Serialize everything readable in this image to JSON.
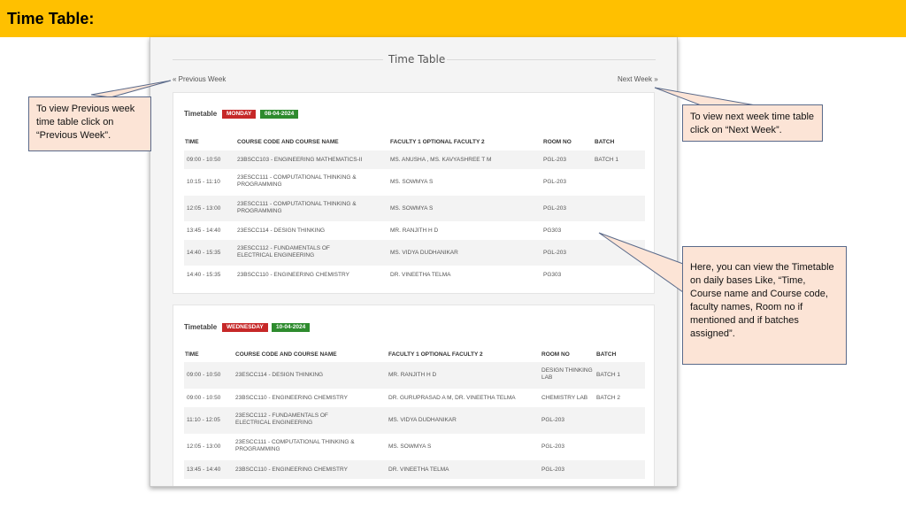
{
  "page": {
    "title": "Time Table:"
  },
  "screenshot": {
    "header": "Time Table",
    "prev_week": "« Previous Week",
    "next_week": "Next Week »",
    "columns": [
      "TIME",
      "COURSE CODE AND COURSE NAME",
      "FACULTY 1 OPTIONAL FACULTY 2",
      "ROOM NO",
      "BATCH"
    ],
    "cards": [
      {
        "label": "Timetable",
        "day": "MONDAY",
        "date": "08-04-2024",
        "rows": [
          {
            "time": "09:00 - 10:50",
            "course": "23BSCC103 - ENGINEERING MATHEMATICS-II",
            "faculty": "MS. ANUSHA , MS. KAVYASHREE T M",
            "room": "PGL-203",
            "batch": "BATCH 1"
          },
          {
            "time": "10:15 - 11:10",
            "course": "23ESCC111 - COMPUTATIONAL THINKING & PROGRAMMING",
            "faculty": "MS. SOWMYA S",
            "room": "PGL-203",
            "batch": ""
          },
          {
            "time": "12:05 - 13:00",
            "course": "23ESCC111 - COMPUTATIONAL THINKING & PROGRAMMING",
            "faculty": "MS. SOWMYA S",
            "room": "PGL-203",
            "batch": ""
          },
          {
            "time": "13:45 - 14:40",
            "course": "23ESCC114 - DESIGN THINKING",
            "faculty": "MR. RANJITH H D",
            "room": "PG303",
            "batch": ""
          },
          {
            "time": "14:40 - 15:35",
            "course": "23ESCC112 - FUNDAMENTALS OF ELECTRICAL ENGINEERING",
            "faculty": "MS. VIDYA DUDHANIKAR",
            "room": "PGL-203",
            "batch": ""
          },
          {
            "time": "14:40 - 15:35",
            "course": "23BSCC110 - ENGINEERING CHEMISTRY",
            "faculty": "DR. VINEETHA TELMA",
            "room": "PG303",
            "batch": ""
          }
        ]
      },
      {
        "label": "Timetable",
        "day": "WEDNESDAY",
        "date": "10-04-2024",
        "rows": [
          {
            "time": "09:00 - 10:50",
            "course": "23ESCC114 - DESIGN THINKING",
            "faculty": "MR. RANJITH H D",
            "room": "DESIGN THINKING LAB",
            "batch": "BATCH 1"
          },
          {
            "time": "09:00 - 10:50",
            "course": "23BSCC110 - ENGINEERING CHEMISTRY",
            "faculty": "DR. GURUPRASAD A M, DR. VINEETHA TELMA",
            "room": "CHEMISTRY LAB",
            "batch": "BATCH 2"
          },
          {
            "time": "11:10 - 12:05",
            "course": "23ESCC112 - FUNDAMENTALS OF ELECTRICAL ENGINEERING",
            "faculty": "MS. VIDYA DUDHANIKAR",
            "room": "PGL-203",
            "batch": ""
          },
          {
            "time": "12:05 - 13:00",
            "course": "23ESCC111 - COMPUTATIONAL THINKING & PROGRAMMING",
            "faculty": "MS. SOWMYA S",
            "room": "PGL-203",
            "batch": ""
          },
          {
            "time": "13:45 - 14:40",
            "course": "23BSCC110 - ENGINEERING CHEMISTRY",
            "faculty": "DR. VINEETHA TELMA",
            "room": "PGL-203",
            "batch": ""
          }
        ]
      }
    ]
  },
  "callouts": {
    "prev": "To view Previous week time table click on “Previous Week”.",
    "next": "To view next week time table click on “Next Week”.",
    "daily": "Here, you can view the Timetable on daily bases Like, “Time, Course name and Course code, faculty names, Room no if mentioned and if batches assigned”."
  },
  "colors": {
    "title_bar": "#FFC000",
    "callout_fill": "#FCE4D6",
    "badge_day": "#c62828",
    "badge_date": "#2e8b2e"
  }
}
